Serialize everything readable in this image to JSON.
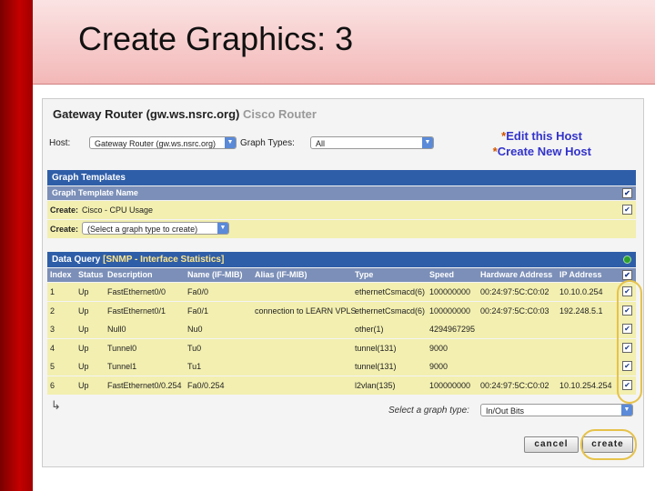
{
  "slide": {
    "title": "Create Graphics: 3"
  },
  "host": {
    "title": "Gateway Router (gw.ws.nsrc.org)",
    "subtitle": "Cisco Router",
    "host_label": "Host:",
    "host_value": "Gateway Router (gw.ws.nsrc.org)",
    "graph_types_label": "Graph Types:",
    "graph_types_value": "All",
    "edit_link": "Edit this Host",
    "create_link": "Create New Host",
    "star": "*"
  },
  "templates": {
    "header": "Graph Templates",
    "column": "Graph Template Name",
    "row1_label": "Create:",
    "row1_value": "Cisco - CPU Usage",
    "row2_label": "Create:",
    "row2_value": "(Select a graph type to create)"
  },
  "query": {
    "header_prefix": "Data Query",
    "header_name": "[SNMP - Interface Statistics]",
    "columns": [
      "Index",
      "Status",
      "Description",
      "Name (IF-MIB)",
      "Alias (IF-MIB)",
      "Type",
      "Speed",
      "Hardware Address",
      "IP Address"
    ],
    "rows": [
      [
        "1",
        "Up",
        "FastEthernet0/0",
        "Fa0/0",
        "",
        "ethernetCsmacd(6)",
        "100000000",
        "00:24:97:5C:C0:02",
        "10.10.0.254"
      ],
      [
        "2",
        "Up",
        "FastEthernet0/1",
        "Fa0/1",
        "connection to LEARN VPLS",
        "ethernetCsmacd(6)",
        "100000000",
        "00:24:97:5C:C0:03",
        "192.248.5.1"
      ],
      [
        "3",
        "Up",
        "Null0",
        "Nu0",
        "",
        "other(1)",
        "4294967295",
        "",
        ""
      ],
      [
        "4",
        "Up",
        "Tunnel0",
        "Tu0",
        "",
        "tunnel(131)",
        "9000",
        "",
        ""
      ],
      [
        "5",
        "Up",
        "Tunnel1",
        "Tu1",
        "",
        "tunnel(131)",
        "9000",
        "",
        ""
      ],
      [
        "6",
        "Up",
        "FastEthernet0/0.254",
        "Fa0/0.254",
        "",
        "l2vlan(135)",
        "100000000",
        "00:24:97:5C:C0:02",
        "10.10.254.254"
      ]
    ],
    "select_label": "Select a graph type:",
    "select_value": "In/Out Bits",
    "arrow": "↳"
  },
  "buttons": {
    "cancel": "cancel",
    "create": "create"
  },
  "colors": {
    "accent_red": "#c40000",
    "header_blue": "#2f5ea8",
    "row_yellow": "#f2efb0",
    "highlight": "#e6c24a"
  }
}
